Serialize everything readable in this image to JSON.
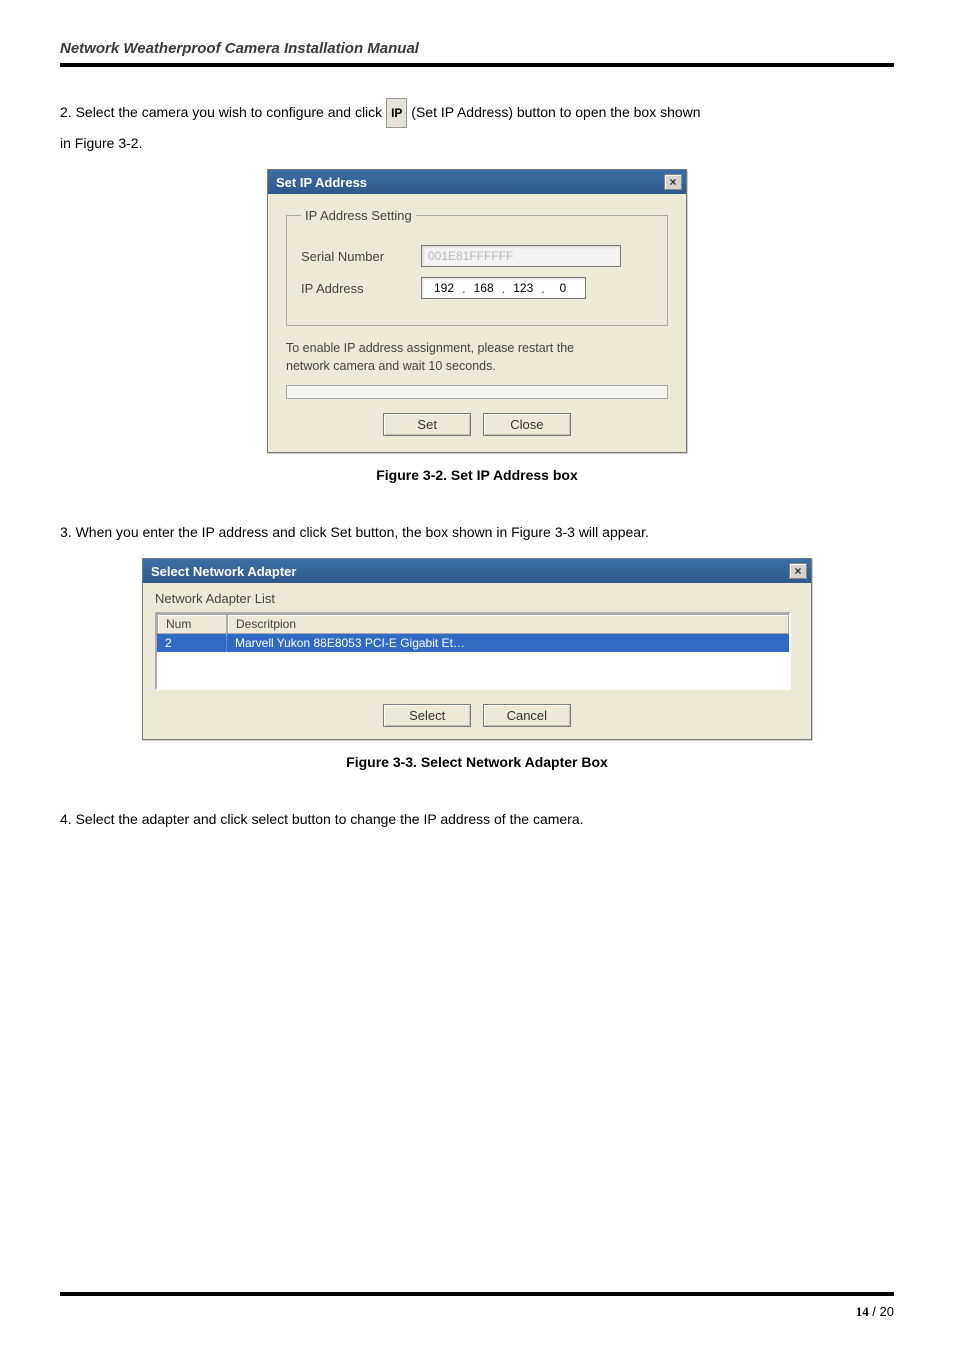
{
  "header": {
    "title": "Network Weatherproof Camera Installation Manual"
  },
  "para1_a": "2. Select the camera you wish to configure and click ",
  "ip_button_label": "IP",
  "para1_b": "(Set IP Address) button to open the box shown",
  "para1_c": "in Figure 3-2.",
  "dialog1": {
    "title": "Set IP Address",
    "close_glyph": "×",
    "group_legend": "IP Address Setting",
    "serial_label": "Serial Number",
    "serial_value": "001E81FFFFFF",
    "ip_label": "IP Address",
    "ip_octets": [
      "192",
      "168",
      "123",
      "0"
    ],
    "hint_line1": "To enable IP address assignment, please restart the",
    "hint_line2": "network camera and wait 10 seconds.",
    "btn_set": "Set",
    "btn_close": "Close"
  },
  "caption1": "Figure 3-2. Set IP Address box",
  "para2": "3. When you enter the IP address and click Set button, the box shown in Figure 3-3 will appear.",
  "dialog2": {
    "title": "Select Network Adapter",
    "close_glyph": "×",
    "list_label": "Network Adapter List",
    "col_num": "Num",
    "col_desc": "Descritpion",
    "row_num": "2",
    "row_desc": "Marvell Yukon 88E8053 PCI-E Gigabit Et…",
    "btn_select": "Select",
    "btn_cancel": "Cancel"
  },
  "caption2": "Figure 3-3. Select Network Adapter Box",
  "para3": "4. Select the adapter and click select button to change the IP address of the camera.",
  "footer": {
    "page_current": "14",
    "page_sep": " / ",
    "page_total": "20"
  }
}
